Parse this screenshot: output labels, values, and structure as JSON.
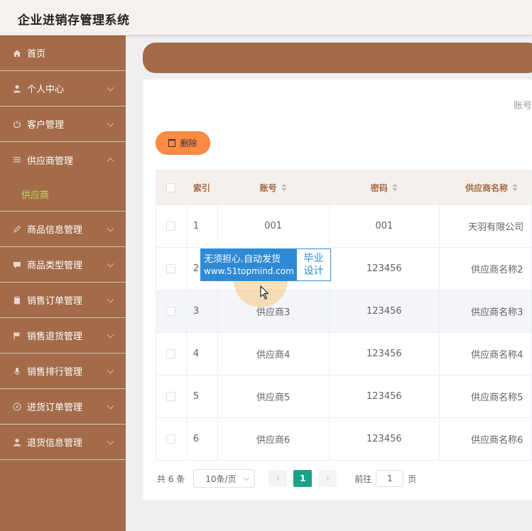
{
  "app": {
    "title": "企业进销存管理系统"
  },
  "sidebar": {
    "items": [
      {
        "label": "首页",
        "icon": "home-icon",
        "chevron": "none"
      },
      {
        "label": "个人中心",
        "icon": "user-icon",
        "chevron": "down"
      },
      {
        "label": "客户管理",
        "icon": "power-icon",
        "chevron": "down"
      },
      {
        "label": "供应商管理",
        "icon": "menu-lines-icon",
        "chevron": "up"
      },
      {
        "label": "商品信息管理",
        "icon": "pen-icon",
        "chevron": "down"
      },
      {
        "label": "商品类型管理",
        "icon": "chat-icon",
        "chevron": "down"
      },
      {
        "label": "销售订单管理",
        "icon": "clipboard-icon",
        "chevron": "down"
      },
      {
        "label": "销售退货管理",
        "icon": "flag-icon",
        "chevron": "down"
      },
      {
        "label": "销售排行管理",
        "icon": "mic-icon",
        "chevron": "down"
      },
      {
        "label": "进货订单管理",
        "icon": "compass-icon",
        "chevron": "down"
      },
      {
        "label": "退货信息管理",
        "icon": "user-icon",
        "chevron": "down"
      }
    ],
    "submenu_active": "供应商"
  },
  "search": {
    "account_label": "账号"
  },
  "toolbar": {
    "delete_label": "删除"
  },
  "table": {
    "headers": {
      "index": "索引",
      "account": "账号",
      "password": "密码",
      "supplier_name": "供应商名称"
    },
    "rows": [
      {
        "index": "1",
        "account": "001",
        "password": "001",
        "supplier_name": "天羽有限公司"
      },
      {
        "index": "2",
        "account": "",
        "password": "123456",
        "supplier_name": "供应商名称2"
      },
      {
        "index": "3",
        "account": "供应商3",
        "password": "123456",
        "supplier_name": "供应商名称3"
      },
      {
        "index": "4",
        "account": "供应商4",
        "password": "123456",
        "supplier_name": "供应商名称4"
      },
      {
        "index": "5",
        "account": "供应商5",
        "password": "123456",
        "supplier_name": "供应商名称5"
      },
      {
        "index": "6",
        "account": "供应商6",
        "password": "123456",
        "supplier_name": "供应商名称6"
      }
    ]
  },
  "pagination": {
    "total": "共 6 条",
    "page_size": "10条/页",
    "prev": "‹",
    "current_page": "1",
    "next": "›",
    "goto_prefix": "前往",
    "goto_value": "1",
    "goto_suffix": "页"
  },
  "watermark": {
    "line1": "无须担心.自动发货",
    "line2": "www.51topmind.com",
    "right1": "毕业",
    "right2": "设计"
  },
  "colors": {
    "sidebar": "#a36b49",
    "active_submenu": "#b5e05a",
    "delete_button": "#fb8a46",
    "page_active": "#1aa38a",
    "watermark_blue": "#2e8ad4"
  }
}
